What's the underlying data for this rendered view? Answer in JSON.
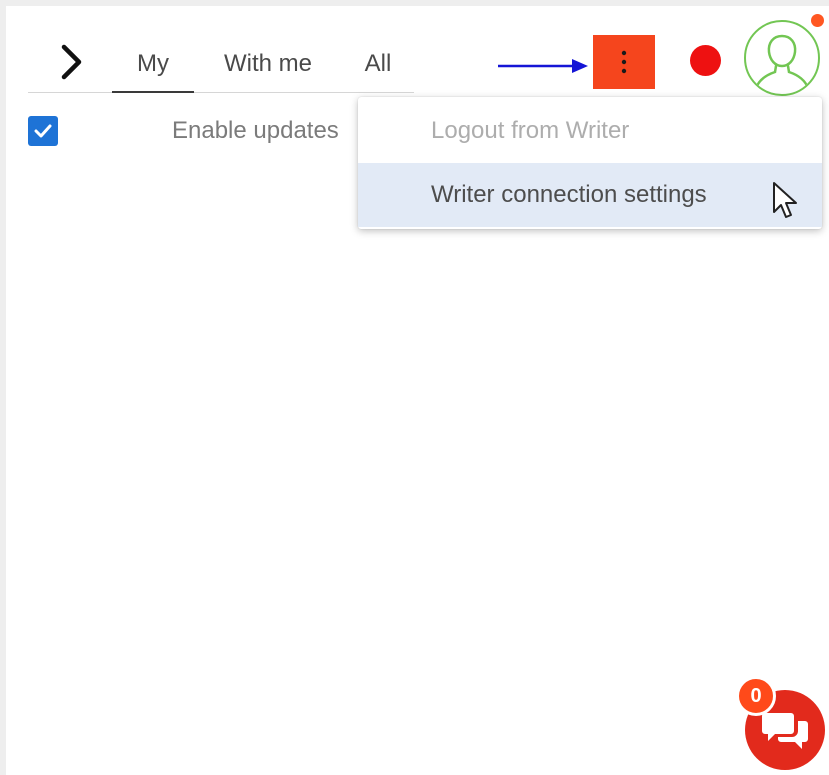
{
  "tabs": [
    {
      "label": "My",
      "active": true
    },
    {
      "label": "With me",
      "active": false
    },
    {
      "label": "All",
      "active": false
    }
  ],
  "filter": {
    "label": "Enable updates",
    "checked": true
  },
  "menu": {
    "items": [
      {
        "label": "Logout from Writer",
        "disabled": true
      },
      {
        "label": "Writer connection settings",
        "hovered": true
      }
    ]
  },
  "chat": {
    "badge_count": "0"
  },
  "colors": {
    "menu_button": "#f5451d",
    "record_dot": "#ee1111",
    "avatar_ring": "#72c653",
    "checkbox": "#1e73d6",
    "chat_button": "#e22a1c",
    "annotation_arrow": "#1515d6"
  },
  "icons": {
    "expand": "chevron-right-icon",
    "menu": "kebab-menu-icon",
    "avatar": "user-silhouette-icon",
    "chat": "chat-bubbles-icon",
    "pointer": "mouse-pointer-icon"
  }
}
